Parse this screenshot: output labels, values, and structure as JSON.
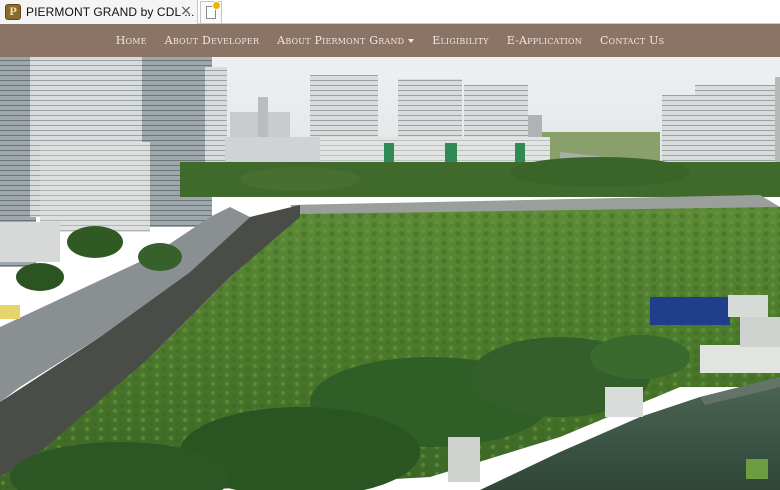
{
  "browser": {
    "tab_title": "PIERMONT GRAND by CDL ...",
    "favicon_letter": "P",
    "close_glyph": "×"
  },
  "nav": {
    "items": [
      {
        "label": "Home",
        "dropdown": false
      },
      {
        "label": "About Developer",
        "dropdown": false
      },
      {
        "label": "About Piermont Grand",
        "dropdown": true
      },
      {
        "label": "Eligibility",
        "dropdown": false
      },
      {
        "label": "E-Application",
        "dropdown": false
      },
      {
        "label": "Contact Us",
        "dropdown": false
      }
    ]
  },
  "colors": {
    "nav_background": "#8b7366",
    "nav_text": "#f1e7df",
    "field_green": "#4e7a2e",
    "water": "#3f5a48"
  },
  "icons": [
    "site-favicon",
    "close-icon",
    "new-tab-icon",
    "chevron-down-icon"
  ]
}
